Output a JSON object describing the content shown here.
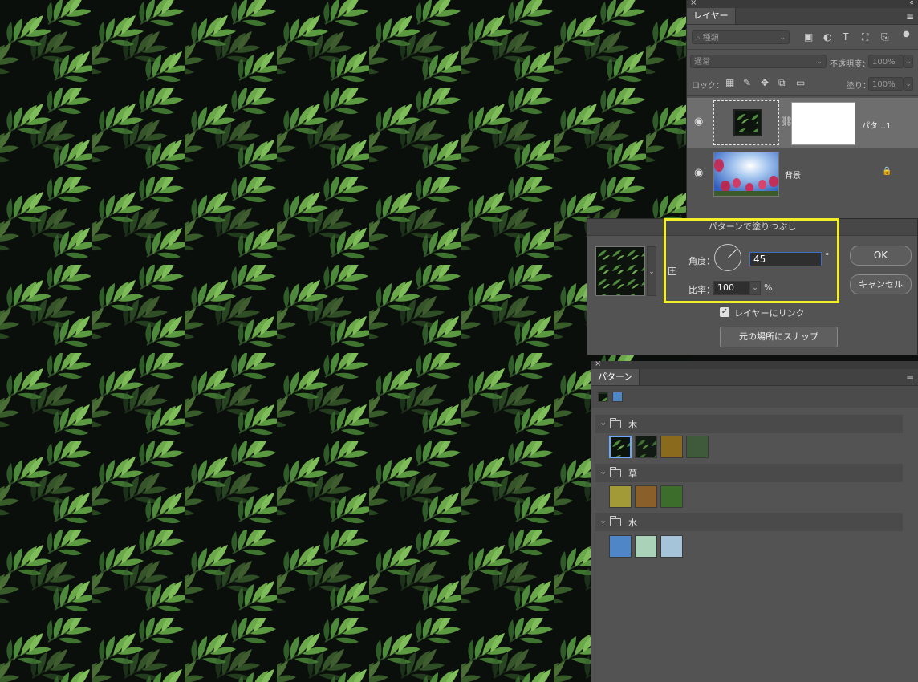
{
  "layers_panel": {
    "tab_label": "レイヤー",
    "filter_placeholder": "種類",
    "blend_mode": "通常",
    "opacity_label": "不透明度：",
    "opacity_value": "100%",
    "lock_label": "ロック：",
    "fill_label": "塗り：",
    "fill_value": "100%",
    "layers": [
      {
        "name": "パタ…1",
        "visible": true,
        "selected": true
      },
      {
        "name": "背景",
        "visible": true,
        "locked": true
      }
    ]
  },
  "dialog": {
    "title": "パターンで塗りつぶし",
    "angle_label": "角度：",
    "angle_value": "45",
    "degree_symbol": "°",
    "scale_label": "比率：",
    "scale_value": "100",
    "percent_symbol": "%",
    "link_label": "レイヤーにリンク",
    "link_checked": true,
    "snap_button": "元の場所にスナップ",
    "ok_button": "OK",
    "cancel_button": "キャンセル",
    "highlight_color": "#f3ee2a"
  },
  "patterns_panel": {
    "tab_label": "パターン",
    "groups": [
      {
        "name": "木",
        "swatches": [
          "#1f3a22",
          "#1a2a1f",
          "#8a6a1c",
          "#3f5a3a"
        ]
      },
      {
        "name": "草",
        "swatches": [
          "#a19a36",
          "#8a5f2a",
          "#3c6d2a"
        ]
      },
      {
        "name": "水",
        "swatches": [
          "#4f86c8",
          "#a9d2b8",
          "#a6c4d9"
        ]
      }
    ]
  },
  "icons": {
    "close": "×",
    "collapse": "«",
    "menu": "≡",
    "chevron": "⌄",
    "check": "✓",
    "plus": "+",
    "eye": "◉",
    "lock": "🔒",
    "link": "⛓"
  }
}
